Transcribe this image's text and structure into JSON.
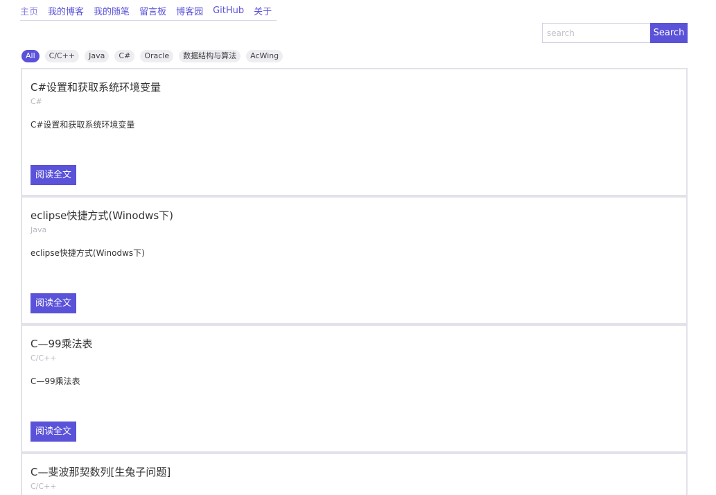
{
  "nav": {
    "items": [
      "主页",
      "我的博客",
      "我的随笔",
      "留言板",
      "博客园",
      "GitHub",
      "关于"
    ]
  },
  "search": {
    "placeholder": "search",
    "button_label": "Search"
  },
  "tags": [
    "All",
    "C/C++",
    "Java",
    "C#",
    "Oracle",
    "数据结构与算法",
    "AcWing"
  ],
  "posts": [
    {
      "title": "C#设置和获取系统环境变量",
      "category": "C#",
      "summary": "C#设置和获取系统环境变量",
      "button": "阅读全文"
    },
    {
      "title": "eclipse快捷方式(Winodws下)",
      "category": "Java",
      "summary": "eclipse快捷方式(Winodws下)",
      "button": "阅读全文"
    },
    {
      "title": "C—99乘法表",
      "category": "C/C++",
      "summary": "C—99乘法表",
      "button": "阅读全文"
    },
    {
      "title": "C—斐波那契数列[生兔子问题]",
      "category": "C/C++"
    }
  ],
  "colors": {
    "accent": "#5a52d8",
    "card_border": "#e2e2ea",
    "tag_bg": "#ededf2"
  }
}
